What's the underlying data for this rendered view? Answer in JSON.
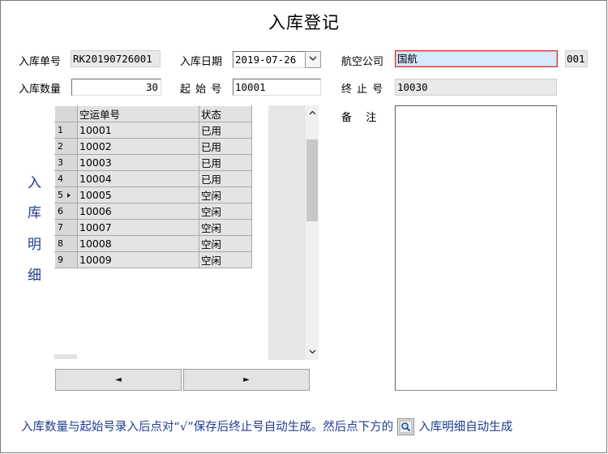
{
  "title": "入库登记",
  "labels": {
    "order_no": "入库单号",
    "date": "入库日期",
    "airline": "航空公司",
    "quantity": "入库数量",
    "start_no": "起 始 号",
    "end_no": "终 止 号",
    "remark": "备  注",
    "detail_vertical": [
      "入",
      "库",
      "明",
      "细"
    ]
  },
  "fields": {
    "order_no": "RK20190726001",
    "date": "2019-07-26",
    "airline_name": "国航",
    "airline_code": "001",
    "quantity": "30",
    "start_no": "10001",
    "end_no": "10030"
  },
  "grid": {
    "columns": [
      "空运单号",
      "状态"
    ],
    "rows": [
      {
        "idx": "1",
        "waybill": "10001",
        "status": "已用"
      },
      {
        "idx": "2",
        "waybill": "10002",
        "status": "已用"
      },
      {
        "idx": "3",
        "waybill": "10003",
        "status": "已用"
      },
      {
        "idx": "4",
        "waybill": "10004",
        "status": "已用"
      },
      {
        "idx": "5",
        "waybill": "10005",
        "status": "空闲"
      },
      {
        "idx": "6",
        "waybill": "10006",
        "status": "空闲"
      },
      {
        "idx": "7",
        "waybill": "10007",
        "status": "空闲"
      },
      {
        "idx": "8",
        "waybill": "10008",
        "status": "空闲"
      },
      {
        "idx": "9",
        "waybill": "10009",
        "status": "空闲"
      }
    ],
    "current_row": "5"
  },
  "nav": {
    "prev": "◄",
    "next": "►"
  },
  "hint": {
    "before": "入库数量与起始号录入后点对“√”保存后终止号自动生成。然后点下方的",
    "after": "入库明细自动生成"
  },
  "icons": {
    "dropdown": "chevron-down-icon",
    "scroll_up": "chevron-up-icon",
    "scroll_down": "chevron-down-icon",
    "row_pointer": "triangle-right-icon",
    "search": "magnifier-icon"
  },
  "colors": {
    "hint_text": "#1f3b8f",
    "airline_bg": "#d7e8fa",
    "airline_border": "#c7383a",
    "grid_bg": "#e4e4e4"
  }
}
